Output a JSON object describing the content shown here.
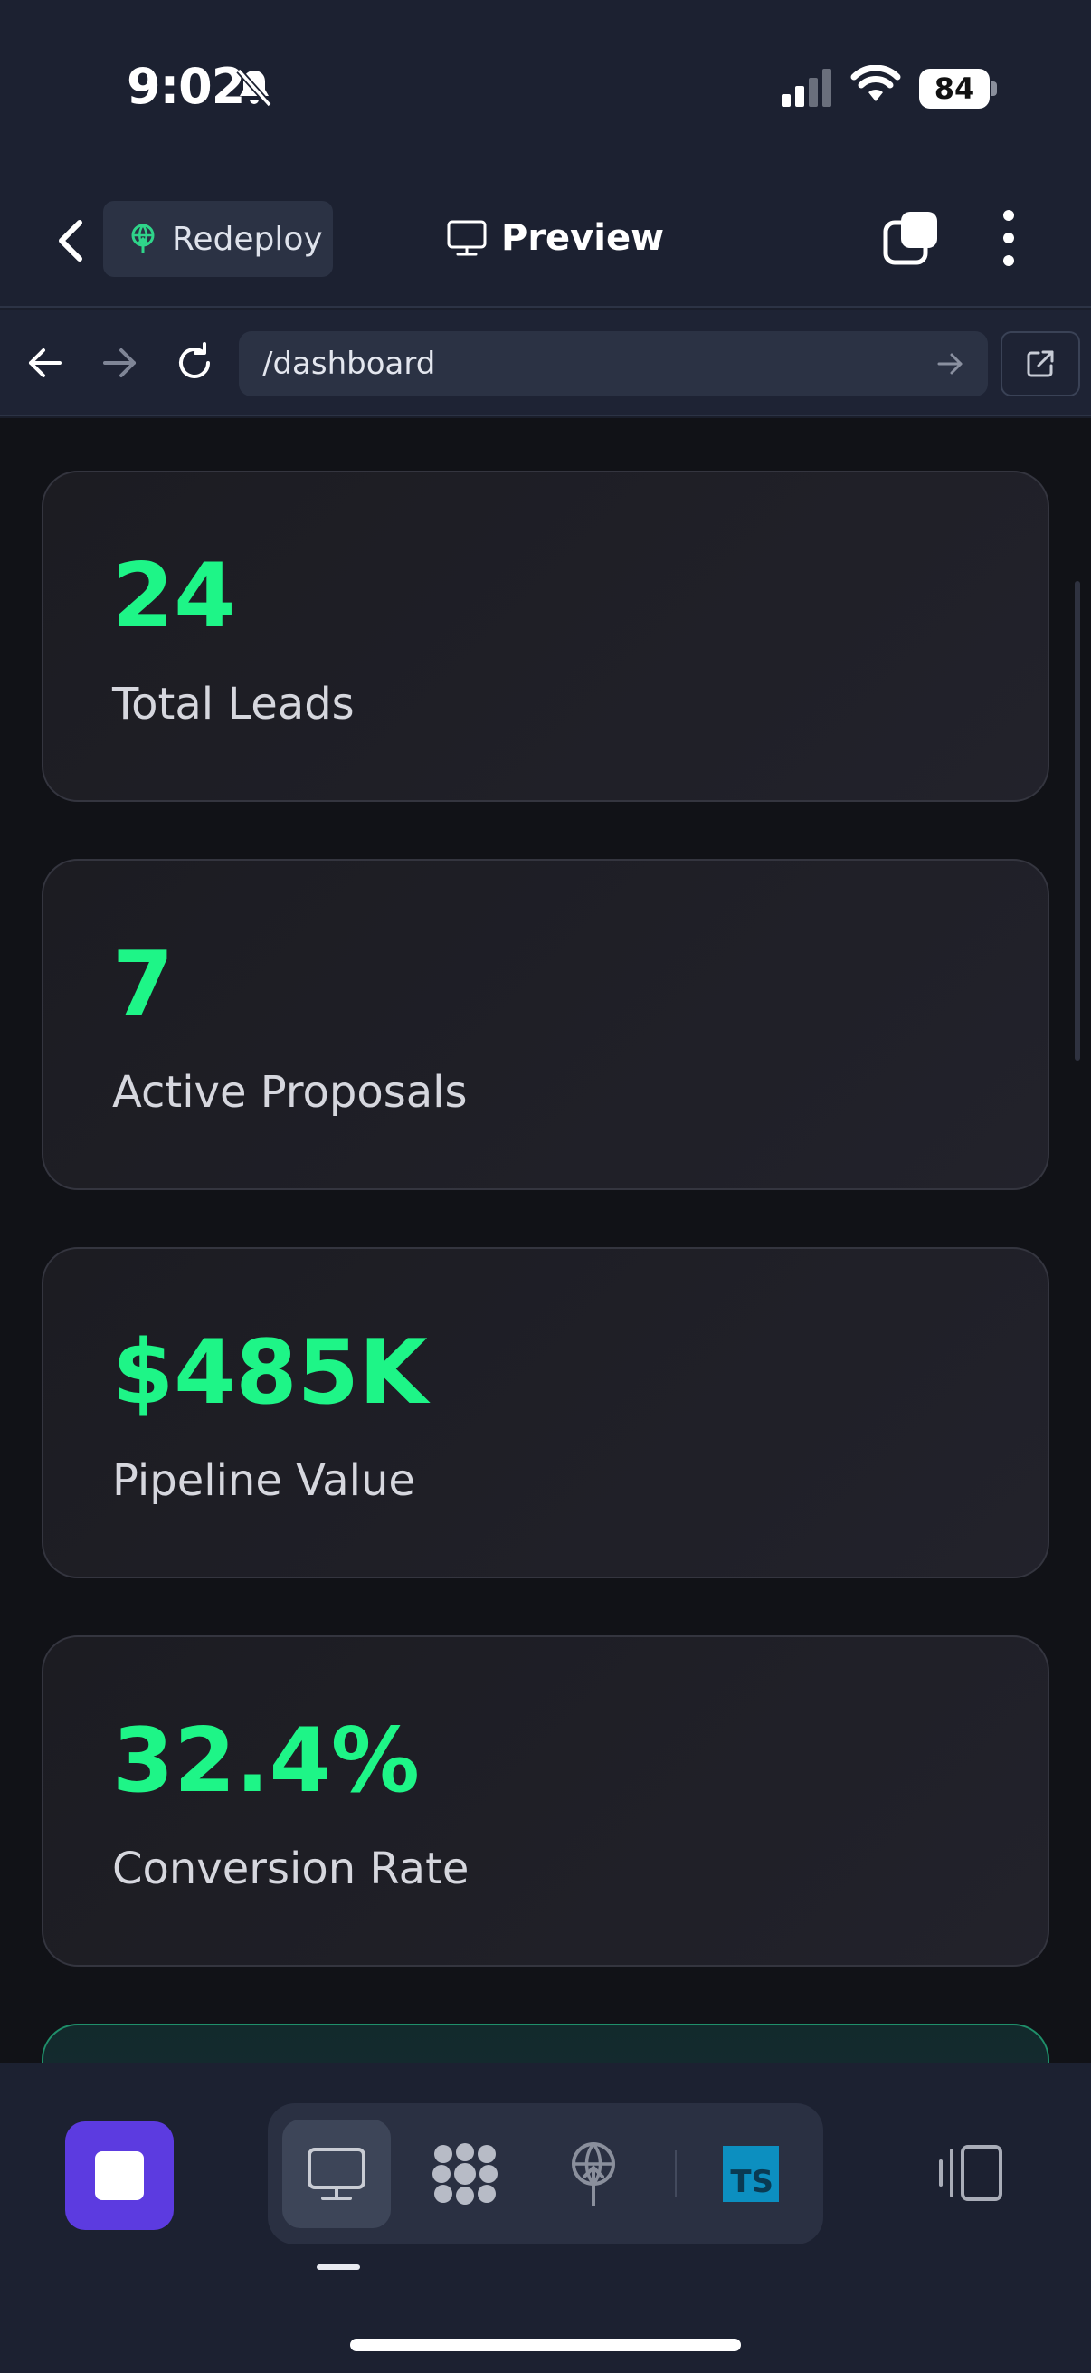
{
  "status_bar": {
    "time": "9:02",
    "battery_level": "84",
    "icons": [
      "bell-slash-icon",
      "cellular-signal-icon",
      "wifi-icon",
      "battery-icon"
    ]
  },
  "header": {
    "redeploy_label": "Redeploy",
    "preview_label": "Preview"
  },
  "browser": {
    "url": "/dashboard"
  },
  "metrics": [
    {
      "value": "24",
      "label": "Total Leads"
    },
    {
      "value": "7",
      "label": "Active Proposals"
    },
    {
      "value": "$485K",
      "label": "Pipeline Value"
    },
    {
      "value": "32.4%",
      "label": "Conversion Rate"
    }
  ],
  "toolbar": {
    "ts_label": "TS",
    "tools": [
      "preview-monitor-icon",
      "grid-dots-icon",
      "deploy-globe-icon",
      "typescript-icon"
    ]
  },
  "colors": {
    "accent_green": "#1ef587",
    "stop_purple": "#5c3be0",
    "background": "#111217"
  }
}
